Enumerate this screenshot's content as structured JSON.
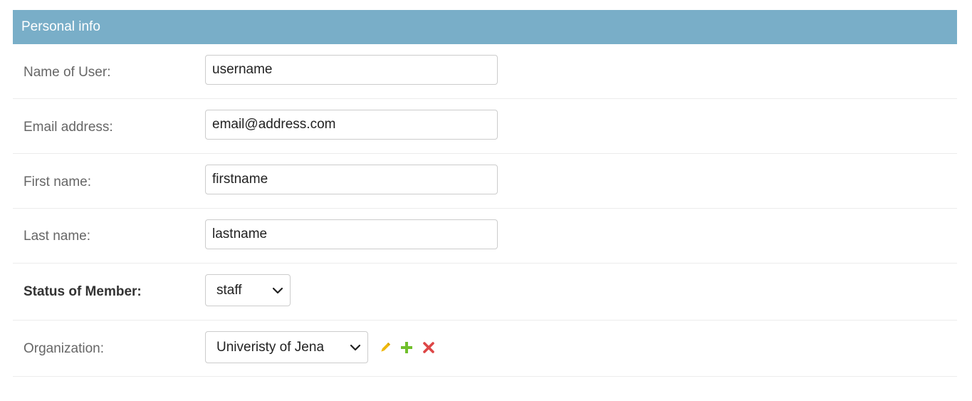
{
  "fieldset": {
    "title": "Personal info"
  },
  "fields": {
    "name_of_user": {
      "label": "Name of User:",
      "value": "username"
    },
    "email": {
      "label": "Email address:",
      "value": "email@address.com"
    },
    "first_name": {
      "label": "First name:",
      "value": "firstname"
    },
    "last_name": {
      "label": "Last name:",
      "value": "lastname"
    },
    "status": {
      "label": "Status of Member:",
      "selected": "staff"
    },
    "organization": {
      "label": "Organization:",
      "selected": "Univeristy of Jena"
    }
  },
  "actions": {
    "edit_icon": "pencil-icon",
    "add_icon": "plus-icon",
    "delete_icon": "x-icon",
    "colors": {
      "edit": "#efb80b",
      "add": "#70bf2b",
      "delete": "#dd4646"
    }
  },
  "colors": {
    "header_bg": "#79aec8",
    "label": "#666666",
    "required_label": "#333333"
  }
}
